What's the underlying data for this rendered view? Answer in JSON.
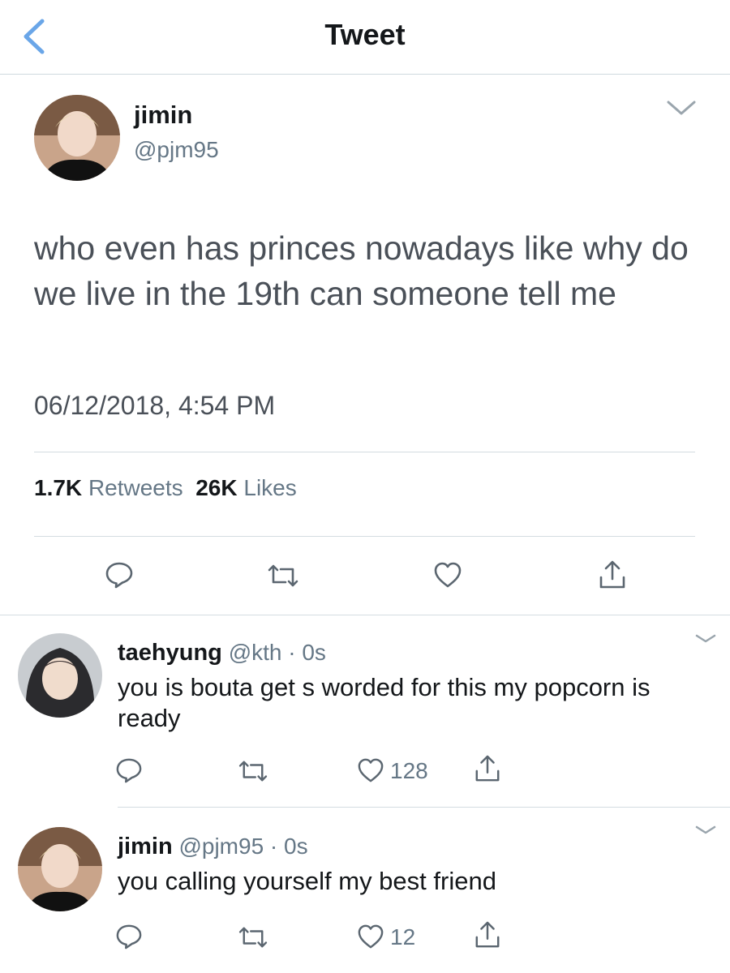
{
  "nav": {
    "title": "Tweet",
    "back_icon": "chevron-left-icon",
    "accent": "#6aa6e8"
  },
  "main_tweet": {
    "name": "jimin",
    "handle": "@pjm95",
    "text": "who even has princes nowadays like why do we live in the 19th can someone tell me",
    "timestamp": "06/12/2018, 4:54 PM",
    "retweets_count": "1.7K",
    "retweets_label": "Retweets",
    "likes_count": "26K",
    "likes_label": "Likes",
    "actions": [
      "reply-icon",
      "retweet-icon",
      "like-icon",
      "share-icon"
    ]
  },
  "replies": [
    {
      "name": "taehyung",
      "handle": "@kth",
      "separator": "·",
      "time": "0s",
      "text": "you is bouta get s worded for this my popcorn is ready",
      "like_count": "128"
    },
    {
      "name": "jimin",
      "handle": "@pjm95",
      "separator": "·",
      "time": "0s",
      "text": "you calling yourself my best friend",
      "like_count": "12"
    }
  ],
  "colors": {
    "text": "#14171a",
    "secondary": "#657786",
    "divider": "#d4dce1",
    "icon": "#5b6670"
  }
}
